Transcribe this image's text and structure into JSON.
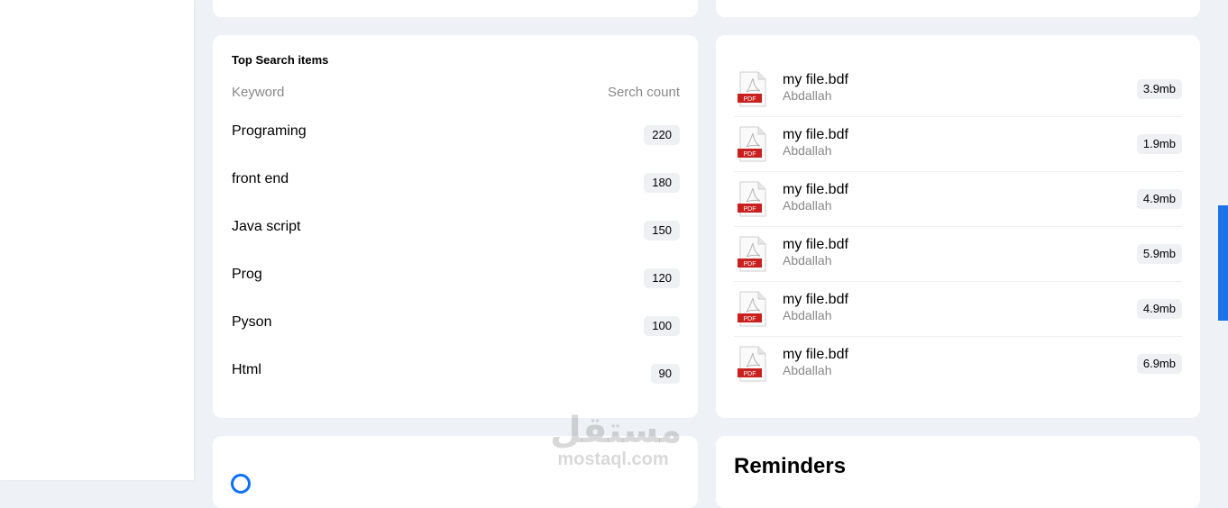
{
  "search_card": {
    "title": "Top Search items",
    "col_keyword": "Keyword",
    "col_count": "Serch count",
    "rows": [
      {
        "keyword": "Programing",
        "count": "220"
      },
      {
        "keyword": "front end",
        "count": "180"
      },
      {
        "keyword": "Java script",
        "count": "150"
      },
      {
        "keyword": "Prog",
        "count": "120"
      },
      {
        "keyword": "Pyson",
        "count": "100"
      },
      {
        "keyword": "Html",
        "count": "90"
      }
    ]
  },
  "files_card": {
    "icon": "pdf-file-icon",
    "files": [
      {
        "name": "my file.bdf",
        "author": "Abdallah",
        "size": "3.9mb"
      },
      {
        "name": "my file.bdf",
        "author": "Abdallah",
        "size": "1.9mb"
      },
      {
        "name": "my file.bdf",
        "author": "Abdallah",
        "size": "4.9mb"
      },
      {
        "name": "my file.bdf",
        "author": "Abdallah",
        "size": "5.9mb"
      },
      {
        "name": "my file.bdf",
        "author": "Abdallah",
        "size": "4.9mb"
      },
      {
        "name": "my file.bdf",
        "author": "Abdallah",
        "size": "6.9mb"
      }
    ]
  },
  "reminders_card": {
    "title": "Reminders"
  },
  "watermark": {
    "arabic": "مستقل",
    "latin": "mostaql.com"
  },
  "colors": {
    "page_bg": "#eef1f6",
    "accent": "#1a73e8",
    "pdf_red": "#c9201e",
    "badge_bg": "#eef0f3",
    "muted_text": "#888888"
  }
}
